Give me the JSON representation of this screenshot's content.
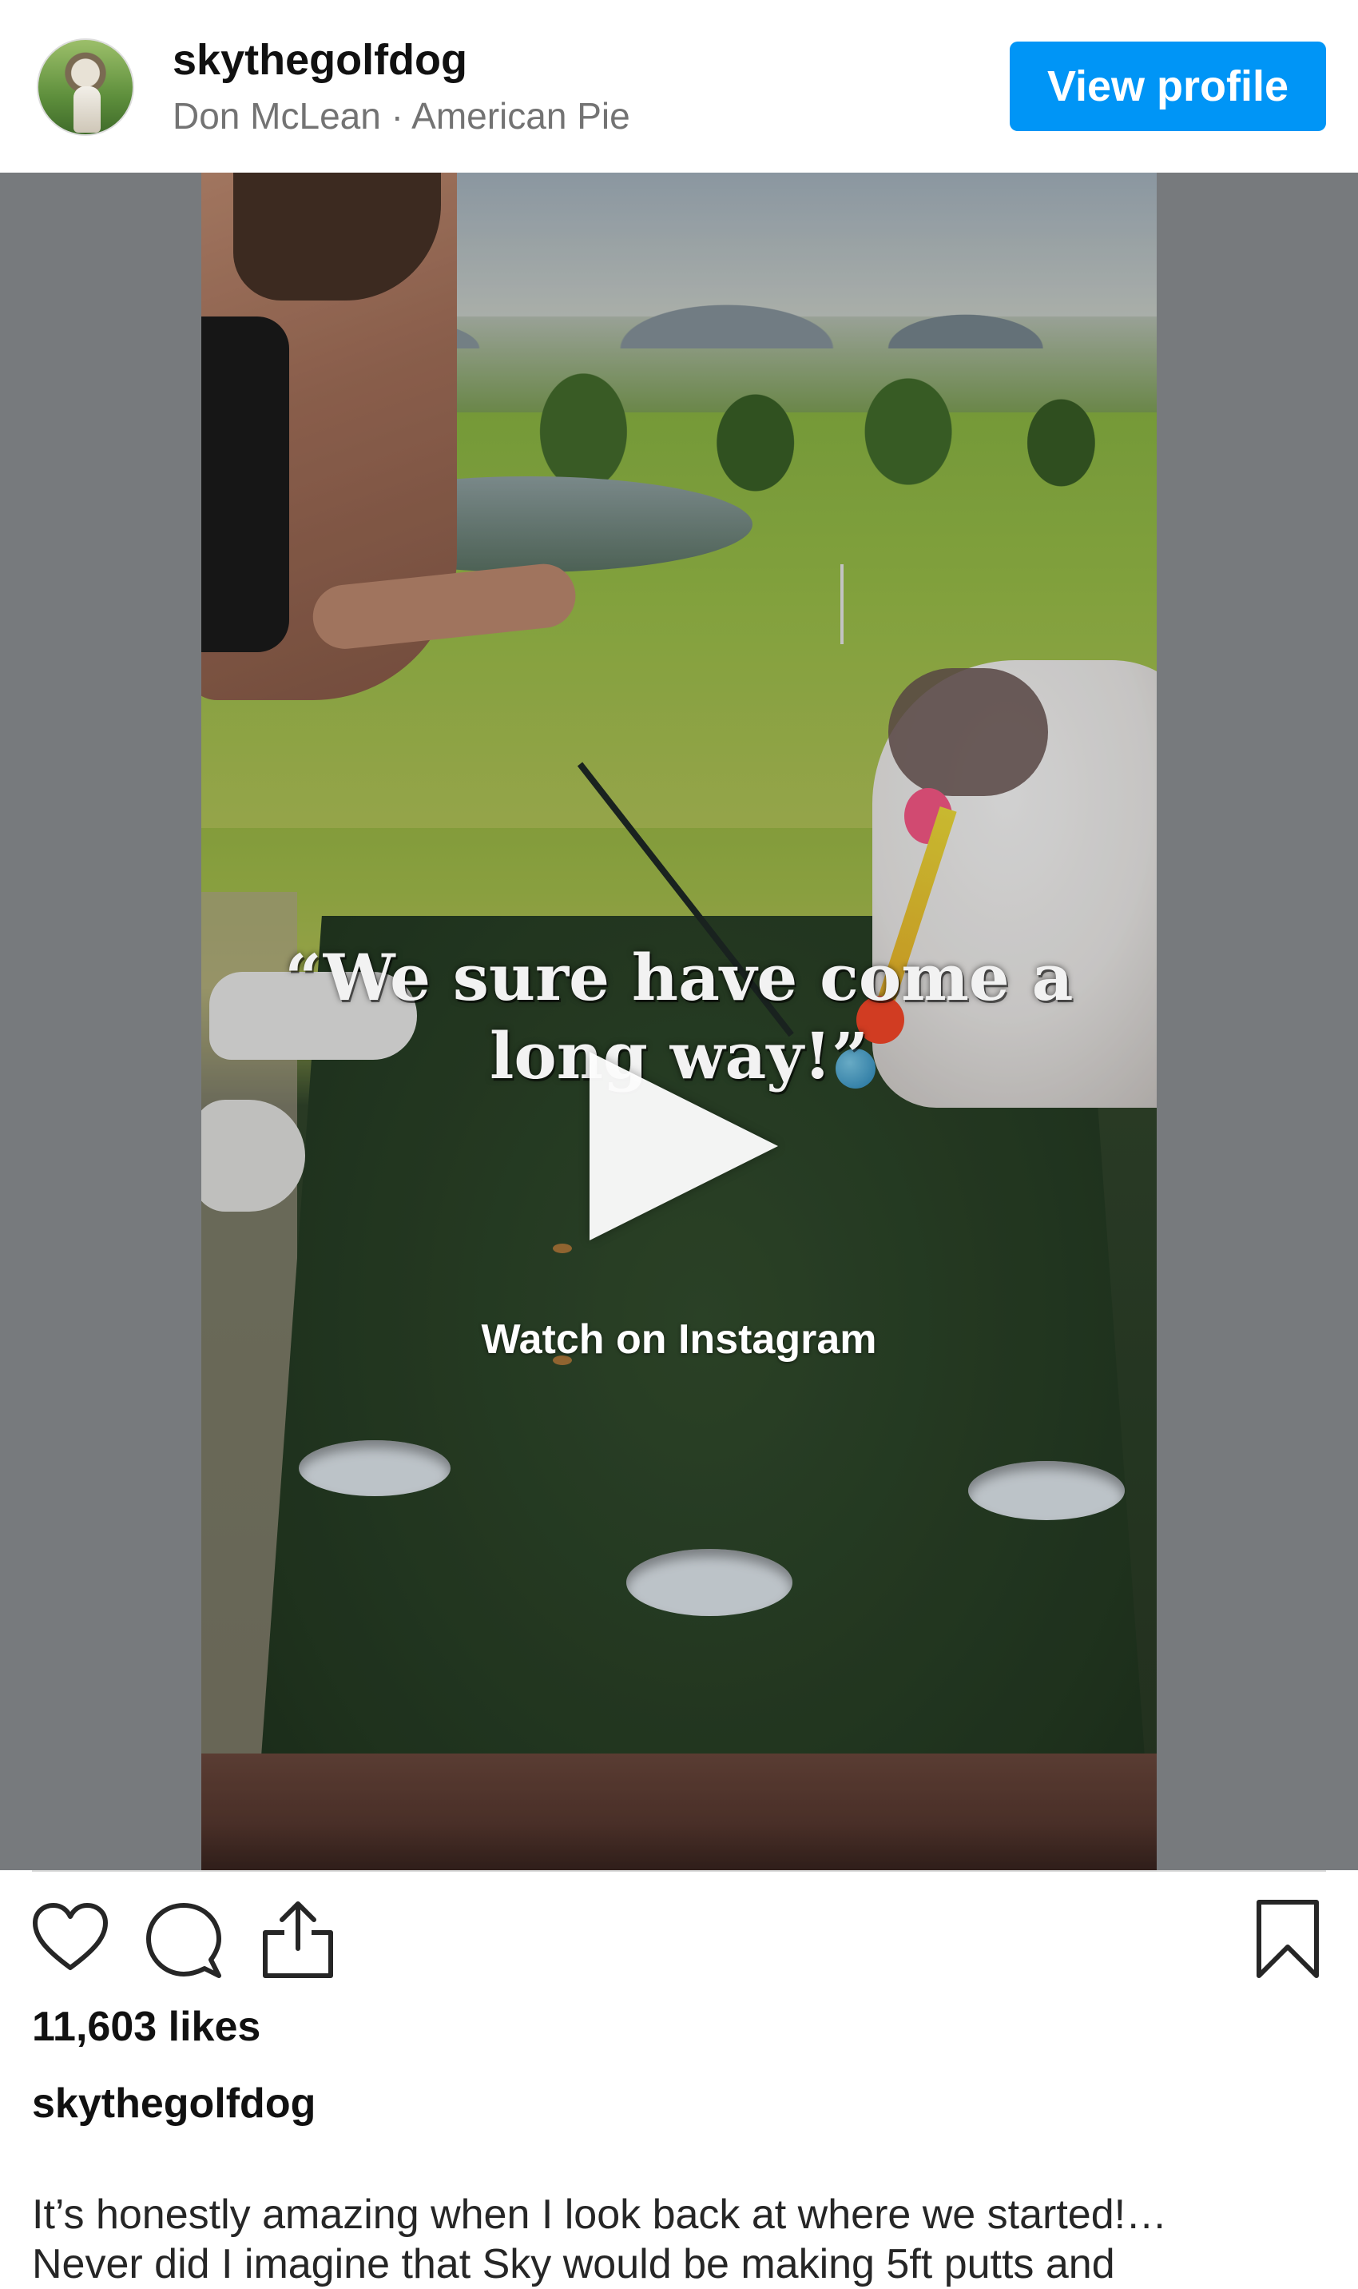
{
  "header": {
    "username": "skythegolfdog",
    "song": "Don McLean · American Pie",
    "view_profile_label": "View profile"
  },
  "media": {
    "overlay_quote_line1": "“We sure have come a",
    "overlay_quote_line2": "long way!”",
    "watch_label": "Watch on Instagram"
  },
  "actions": {
    "like_icon": "heart-icon",
    "comment_icon": "comment-icon",
    "share_icon": "share-icon",
    "save_icon": "bookmark-icon"
  },
  "post": {
    "likes": "11,603 likes",
    "caption_user": "skythegolfdog",
    "caption_line1": "It’s honestly amazing when I look back at where we started!…",
    "caption_line2": "Never did I imagine that Sky would be making 5ft putts and"
  },
  "colors": {
    "accent": "#0095f6",
    "secondary_text": "#737373",
    "media_backdrop": "#777a7d"
  }
}
